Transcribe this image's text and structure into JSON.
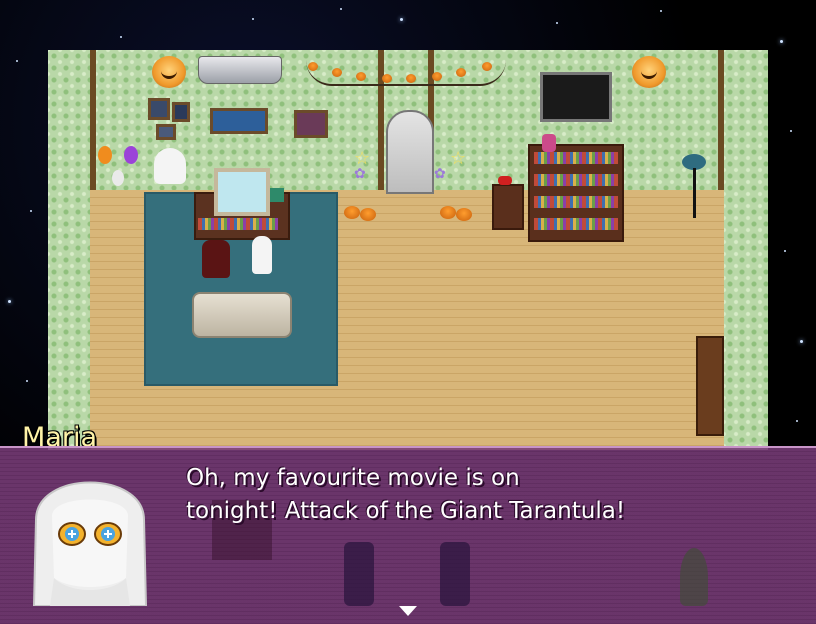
{
  "dialog": {
    "speaker_name": "Maria",
    "message": "Oh, my favourite movie is on\ntonight! Attack of the Giant Tarantula!"
  },
  "colors": {
    "speaker_name": "#fff3a8",
    "dialog_background": "#7a3c7a",
    "wall": "#b9d8a8",
    "floor": "#d8b679",
    "rug": "#356f7c"
  },
  "icons": [
    "jack-o-lantern-icon",
    "pumpkin-icon",
    "balloon-icon",
    "ghost-icon",
    "candelabra-icon",
    "potted-plant-icon",
    "next-page-arrow-icon"
  ]
}
